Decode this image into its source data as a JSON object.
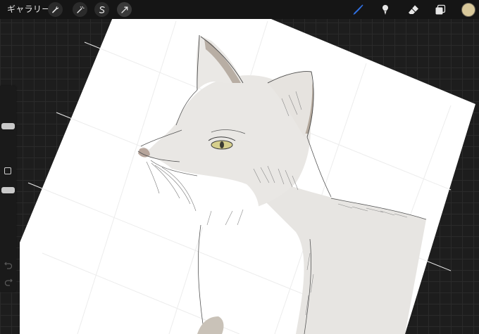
{
  "topbar": {
    "gallery_label": "ギャラリー",
    "tools_left": [
      "wrench-icon",
      "magic-wand-icon",
      "selection-icon",
      "transform-arrow-icon"
    ],
    "tools_right": [
      "brush-icon",
      "smudge-icon",
      "eraser-icon",
      "layers-icon"
    ],
    "active_tool": "brush-icon",
    "current_color": "#d8c89a"
  },
  "sidebar": {
    "brush_size_level": 0.25,
    "opacity_level": 0.55
  },
  "colors": {
    "app_background": "#1d1d1d",
    "toolbar": "#151515",
    "active_tool_accent": "#2f6fe0",
    "paper": "#ffffff"
  }
}
